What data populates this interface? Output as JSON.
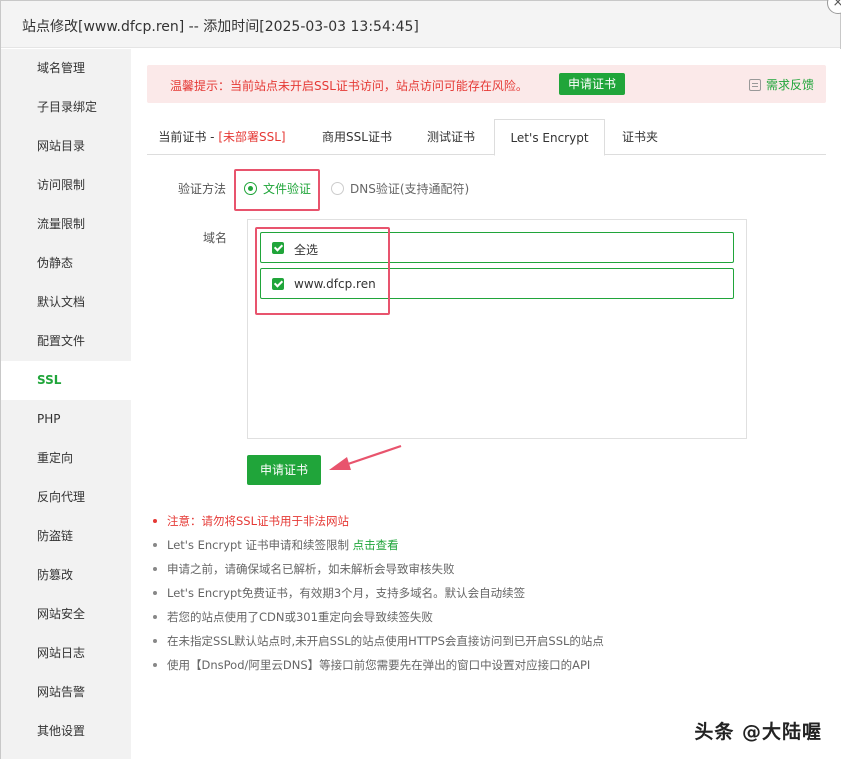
{
  "window": {
    "title": "站点修改[www.dfcp.ren] -- 添加时间[2025-03-03 13:54:45]",
    "close_glyph": "×"
  },
  "sidebar": {
    "items": [
      {
        "label": "域名管理"
      },
      {
        "label": "子目录绑定"
      },
      {
        "label": "网站目录"
      },
      {
        "label": "访问限制"
      },
      {
        "label": "流量限制"
      },
      {
        "label": "伪静态"
      },
      {
        "label": "默认文档"
      },
      {
        "label": "配置文件"
      },
      {
        "label": "SSL"
      },
      {
        "label": "PHP"
      },
      {
        "label": "重定向"
      },
      {
        "label": "反向代理"
      },
      {
        "label": "防盗链"
      },
      {
        "label": "防篡改"
      },
      {
        "label": "网站安全"
      },
      {
        "label": "网站日志"
      },
      {
        "label": "网站告警"
      },
      {
        "label": "其他设置"
      }
    ],
    "active": "SSL"
  },
  "alert": {
    "message": "温馨提示：当前站点未开启SSL证书访问，站点访问可能存在风险。",
    "apply_label": "申请证书",
    "feedback_label": "需求反馈"
  },
  "tabs": {
    "current_prefix": "当前证书 - ",
    "current_status": "[未部署SSL]",
    "commercial": "商用SSL证书",
    "test": "测试证书",
    "letsencrypt": "Let's Encrypt",
    "folder": "证书夹",
    "active": "Let's Encrypt"
  },
  "form": {
    "verify_label": "验证方法",
    "verify_options": {
      "file": "文件验证",
      "dns": "DNS验证(支持通配符)"
    },
    "verify_selected": "文件验证",
    "domain_label": "域名",
    "domains": [
      {
        "label": "全选",
        "checked": true
      },
      {
        "label": "www.dfcp.ren",
        "checked": true
      }
    ],
    "apply_label": "申请证书"
  },
  "notes": {
    "n1": "注意：请勿将SSL证书用于非法网站",
    "n2_text": "Let's Encrypt 证书申请和续签限制 ",
    "n2_link": "点击查看",
    "n3": "申请之前，请确保域名已解析，如未解析会导致审核失败",
    "n4": "Let's Encrypt免费证书，有效期3个月，支持多域名。默认会自动续签",
    "n5": "若您的站点使用了CDN或301重定向会导致续签失败",
    "n6": "在未指定SSL默认站点时,未开启SSL的站点使用HTTPS会直接访问到已开启SSL的站点",
    "n7": "使用【DnsPod/阿里云DNS】等接口前您需要先在弹出的窗口中设置对应接口的API"
  },
  "watermark": "头条 @大陆喔",
  "colors": {
    "accent": "#20a53a",
    "danger": "#e53935",
    "annotation": "#e8546d"
  }
}
